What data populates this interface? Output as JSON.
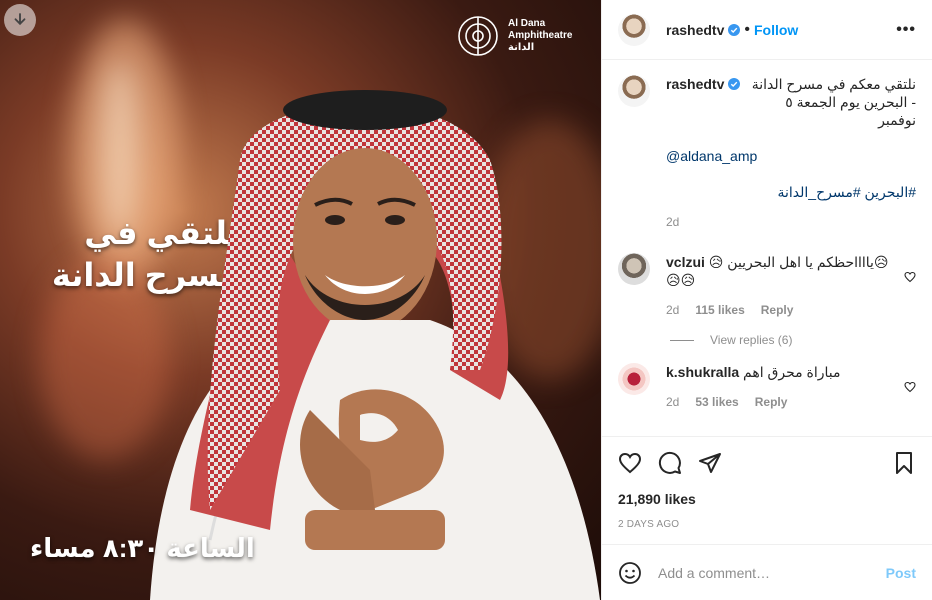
{
  "media": {
    "brand_en_1": "Al Dana",
    "brand_en_2": "Amphitheatre",
    "brand_ar": "الدانة",
    "headline_1": "نلتقي في",
    "headline_2": "مسرح الدانة",
    "time_text": "الساعة ٨:٣٠ مساء"
  },
  "header": {
    "username": "rashedtv",
    "follow_label": "Follow",
    "dot": "•",
    "more": "•••"
  },
  "caption": {
    "username": "rashedtv",
    "text": "نلتقي معكم في مسرح الدانة - البحرين يوم الجمعة ٥ نوفمبر",
    "mention": "@aldana_amp",
    "hashtags": "#البحرين #مسرح_الدانة",
    "time": "2d"
  },
  "comments": [
    {
      "username": "vclzui",
      "text": "😥يااااحظكم يا اهل البحريين 😥😥😥",
      "time": "2d",
      "likes": "115 likes",
      "reply": "Reply"
    },
    {
      "username": "k.shukralla",
      "text": "مباراة محرق اهم",
      "time": "2d",
      "likes": "53 likes",
      "reply": "Reply"
    }
  ],
  "view_replies": "View replies (6)",
  "likes_count": "21,890 likes",
  "posted_ago": "2 DAYS AGO",
  "add_comment": {
    "placeholder": "Add a comment…",
    "post_label": "Post"
  },
  "colors": {
    "link_blue": "#0095f6",
    "text": "#262626",
    "muted": "#8e8e8e"
  }
}
